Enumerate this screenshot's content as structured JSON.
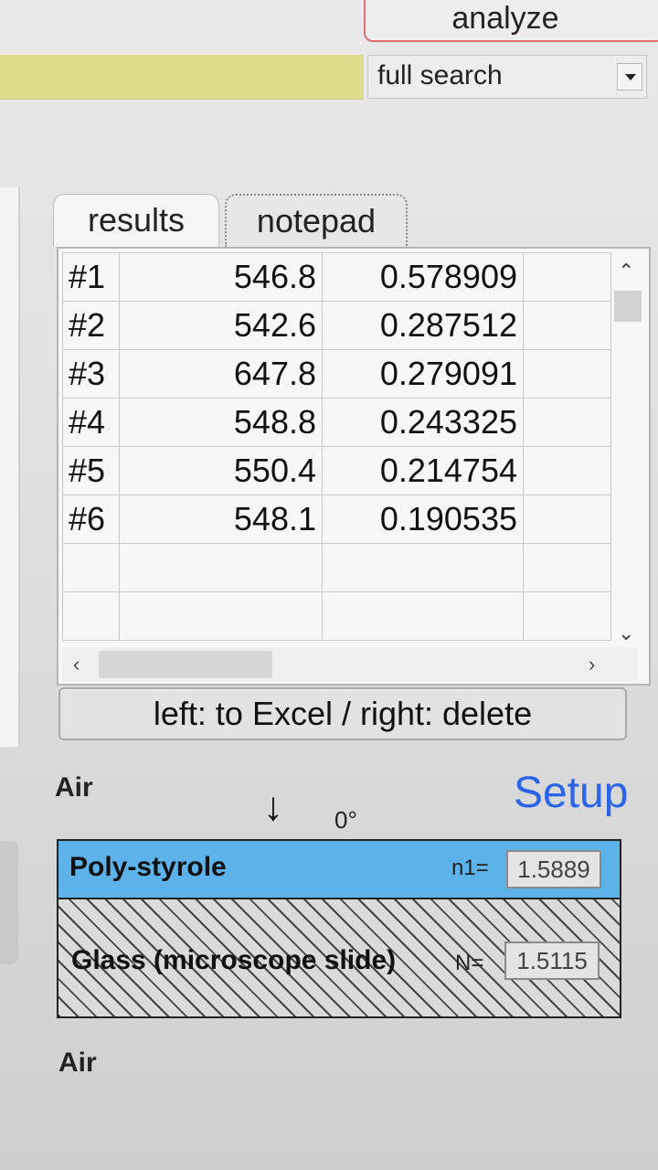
{
  "toolbar": {
    "analyze_label": "analyze",
    "search_mode": "full search"
  },
  "tabs": [
    {
      "label": "results",
      "active": true
    },
    {
      "label": "notepad",
      "active": false
    }
  ],
  "results": {
    "rows": [
      {
        "id": "#1",
        "wavelength": "546.8",
        "value": "0.578909"
      },
      {
        "id": "#2",
        "wavelength": "542.6",
        "value": "0.287512"
      },
      {
        "id": "#3",
        "wavelength": "647.8",
        "value": "0.279091"
      },
      {
        "id": "#4",
        "wavelength": "548.8",
        "value": "0.243325"
      },
      {
        "id": "#5",
        "wavelength": "550.4",
        "value": "0.214754"
      },
      {
        "id": "#6",
        "wavelength": "548.1",
        "value": "0.190535"
      }
    ],
    "action_label": "left: to Excel / right: delete"
  },
  "stack": {
    "top_medium": "Air",
    "bottom_medium": "Air",
    "setup_label": "Setup",
    "angle": "0°",
    "layers": [
      {
        "name": "Poly-styrole",
        "n_label": "n1=",
        "n_value": "1.5889",
        "color": "#5db2ea"
      },
      {
        "name": "Glass (microscope slide)",
        "n_label": "N=",
        "n_value": "1.5115",
        "pattern": "hatched"
      }
    ]
  },
  "colors": {
    "accent_link": "#2a64e8",
    "highlight_field": "#dcdc8a",
    "analyze_border": "#e07070"
  }
}
